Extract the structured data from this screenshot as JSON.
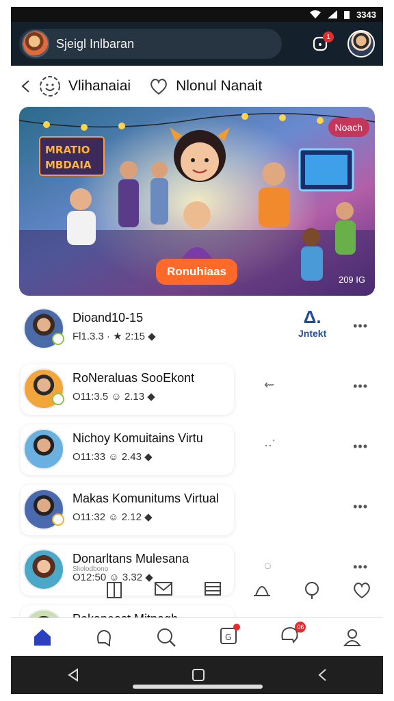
{
  "status": {
    "time": "3343"
  },
  "header": {
    "title": "Sjeigl Inlbaran",
    "notif_badge": "1"
  },
  "tabs": [
    {
      "label": "Vlihanaiai",
      "icon": "smiley-gear-icon"
    },
    {
      "label": "Nlonul Nanait",
      "icon": "heart-icon"
    }
  ],
  "banner": {
    "sign": "MRATIO MBDAIA",
    "badge": "Noach",
    "cta": "Ronuhiaas",
    "count": "209 IG"
  },
  "list": [
    {
      "name": "Dioand10-15",
      "meta": "Fl1.3.3 · ★ 2:15 ◆",
      "side": "",
      "brand": {
        "big": "Δ.",
        "small": "Jntekt"
      }
    },
    {
      "name": "RoNeraluas SooEkont",
      "meta": "O11:3.5 ☺ 2.13 ◆",
      "side": "⇜"
    },
    {
      "name": "Nichoy Komuitains Virtu",
      "meta": "O11:33 ☺ 2.43 ◆",
      "side": "··˙"
    },
    {
      "name": "Makas Komunitums Virtual",
      "meta": "O11:32 ☺ 2.12 ◆",
      "side": ""
    },
    {
      "name": "Donarltans Mulesana",
      "meta": "O12:50 ☺ 3.32 ◆",
      "sub": "Sliolodbono",
      "side": "◌"
    },
    {
      "name": "Pokaneast Mitnagh",
      "meta": "",
      "side": ""
    }
  ],
  "bottom_nav": {
    "messages_badge": "06"
  },
  "colors": {
    "accent": "#2b3fbf",
    "orange": "#ff6a2b",
    "badge": "#e52b2b"
  }
}
